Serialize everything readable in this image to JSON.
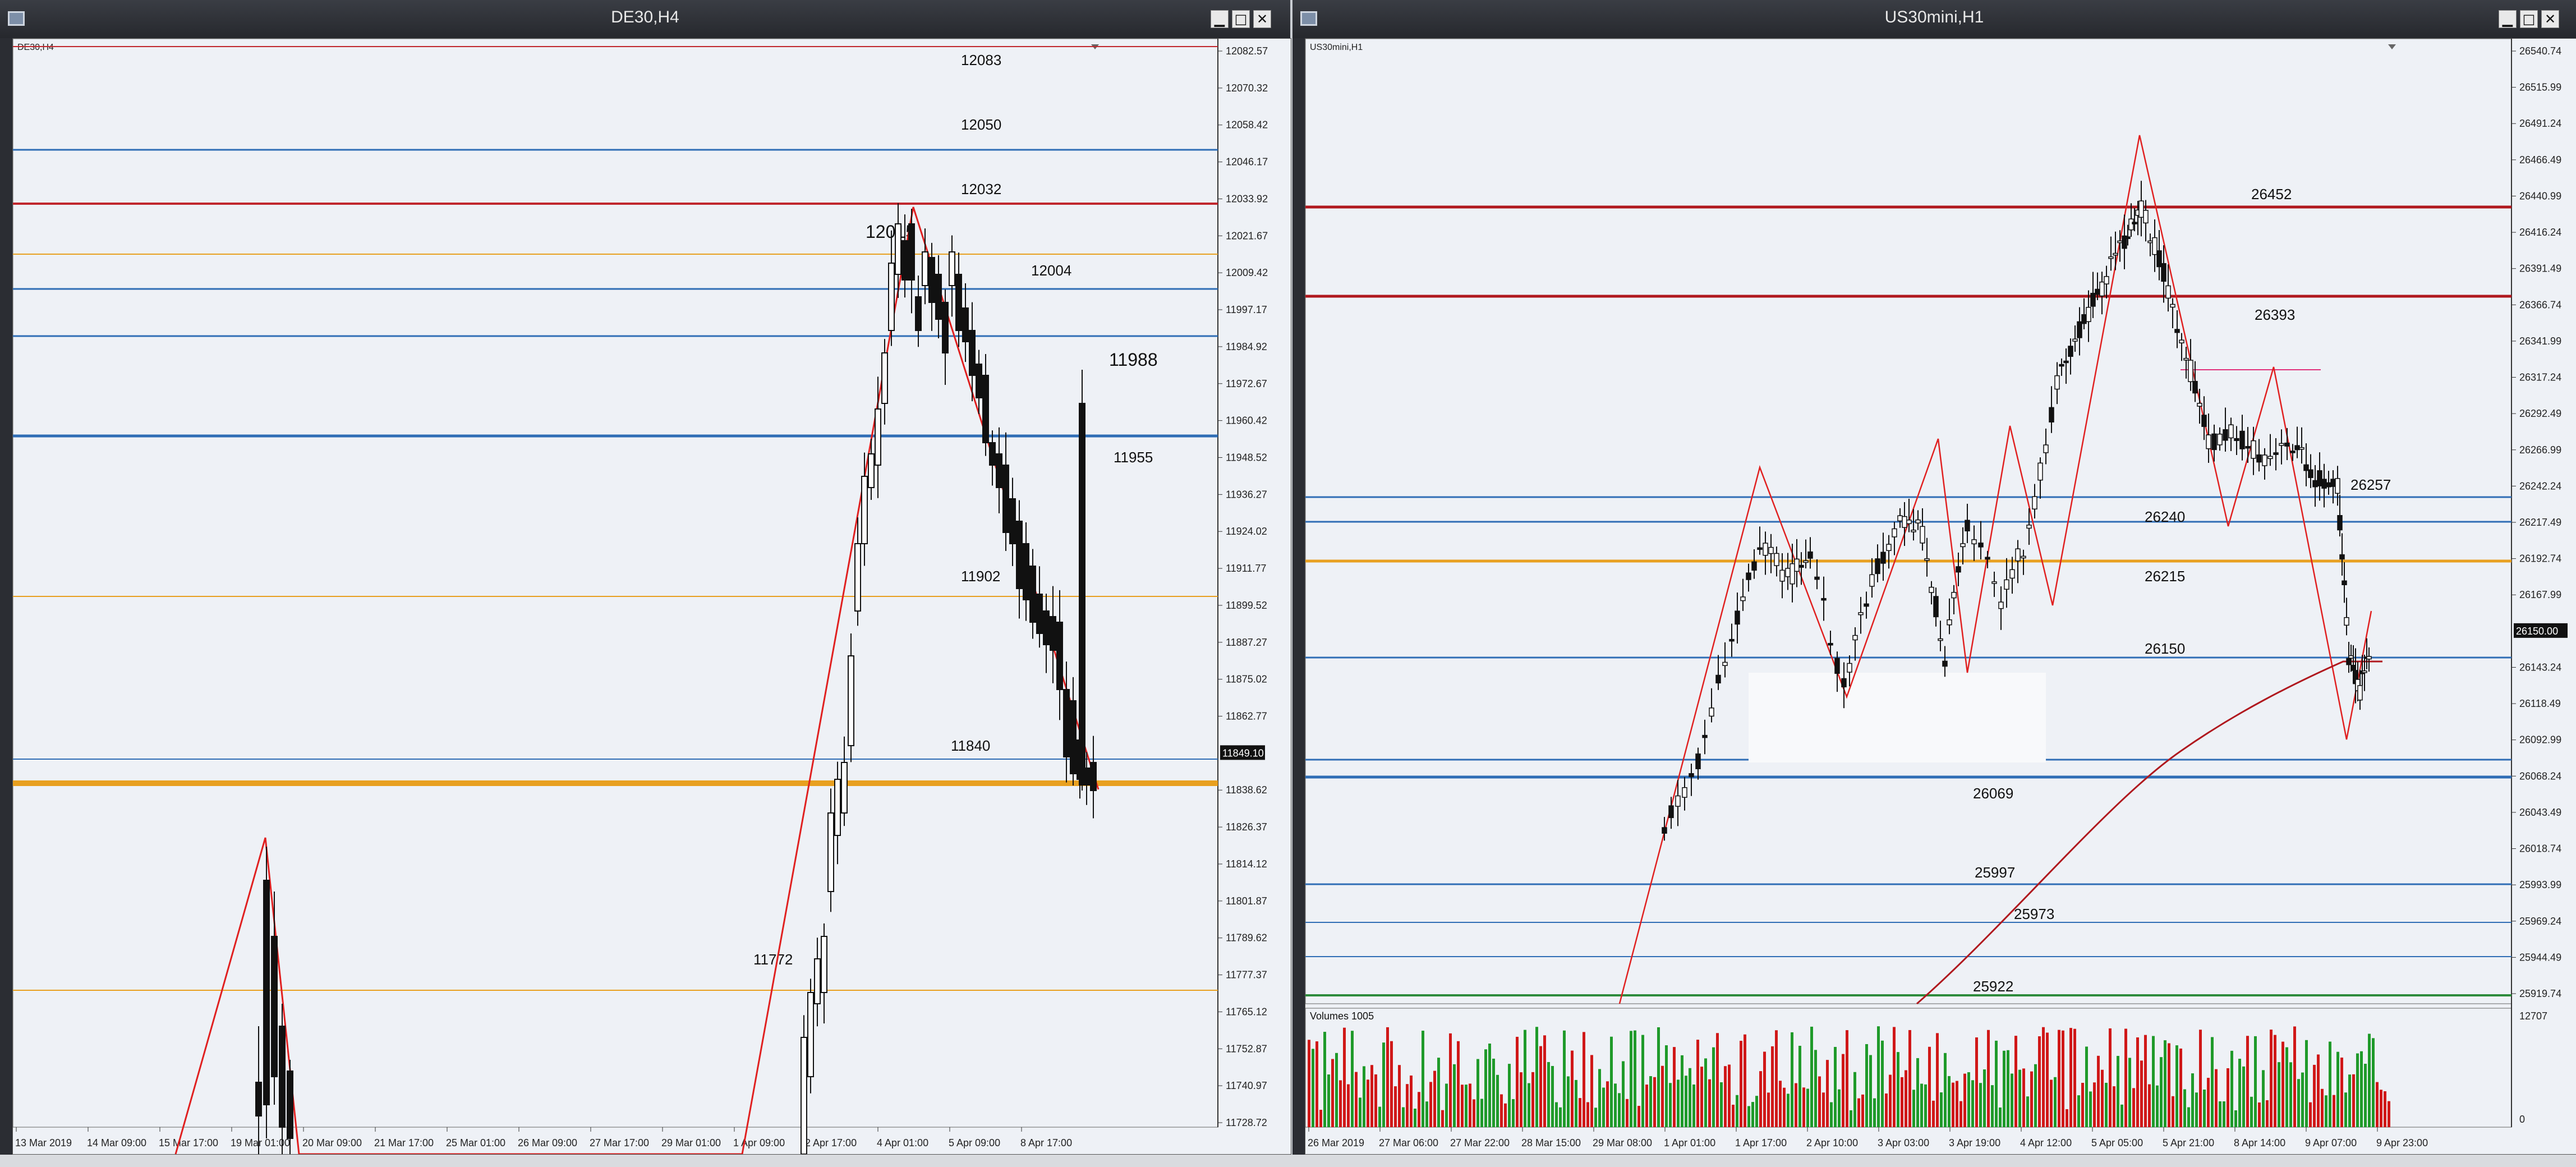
{
  "windows": [
    {
      "title": "DE30,H4",
      "symbol_label": "DE30,H4",
      "price_ticks": [
        "12082.57",
        "12070.32",
        "12058.42",
        "12046.17",
        "12033.92",
        "12021.67",
        "12009.42",
        "11997.17",
        "11984.92",
        "11972.67",
        "11960.42",
        "11948.52",
        "11936.27",
        "11924.02",
        "11911.77",
        "11899.52",
        "11887.27",
        "11875.02",
        "11862.77",
        "11849.10",
        "11838.62",
        "11826.37",
        "11814.12",
        "11801.87",
        "11789.62",
        "11777.37",
        "11765.12",
        "11752.87",
        "11740.97",
        "11728.72"
      ],
      "current_price": "11849.10",
      "time_labels": [
        "13 Mar 2019",
        "14 Mar 09:00",
        "15 Mar 17:00",
        "19 Mar 01:00",
        "20 Mar 09:00",
        "21 Mar 17:00",
        "25 Mar 01:00",
        "26 Mar 09:00",
        "27 Mar 17:00",
        "29 Mar 01:00",
        "1 Apr 09:00",
        "2 Apr 17:00",
        "4 Apr 01:00",
        "5 Apr 09:00",
        "8 Apr 17:00"
      ],
      "level_labels": [
        "12083",
        "12050",
        "12032",
        "12015",
        "12004",
        "11988",
        "11955",
        "11902",
        "11840",
        "11772"
      ],
      "line_colors": {
        "red": "#c0272d",
        "blue": "#2f6db5",
        "orange": "#e8a020",
        "zigzag": "#e02020"
      }
    },
    {
      "title": "US30mini,H1",
      "symbol_label": "US30mini,H1",
      "price_ticks": [
        "26540.74",
        "26515.99",
        "26491.24",
        "26466.49",
        "26440.99",
        "26416.24",
        "26391.49",
        "26366.74",
        "26341.99",
        "26317.24",
        "26292.49",
        "26266.99",
        "26242.24",
        "26217.49",
        "26192.74",
        "26167.99",
        "26150.00",
        "26143.24",
        "26118.49",
        "26092.99",
        "26068.24",
        "26043.49",
        "26018.74",
        "25993.99",
        "25969.24",
        "25944.49",
        "25919.74"
      ],
      "current_price": "26150.00",
      "time_labels": [
        "26 Mar 2019",
        "27 Mar 06:00",
        "27 Mar 22:00",
        "28 Mar 15:00",
        "29 Mar 08:00",
        "1 Apr 01:00",
        "1 Apr 17:00",
        "2 Apr 10:00",
        "3 Apr 03:00",
        "3 Apr 19:00",
        "4 Apr 12:00",
        "5 Apr 05:00",
        "5 Apr 21:00",
        "8 Apr 14:00",
        "9 Apr 07:00",
        "9 Apr 23:00"
      ],
      "level_labels": [
        "26452",
        "26393",
        "26257",
        "26240",
        "26215",
        "26150",
        "26069",
        "25997",
        "25973",
        "25922"
      ],
      "volume_label": "Volumes 1005",
      "volume_ticks": [
        "12707",
        "0"
      ],
      "line_colors": {
        "red": "#b0181e",
        "blue": "#2f6db5",
        "orange": "#e8a020",
        "green": "#2e8b3c",
        "ma": "#b0181e",
        "volume_up": "#1f9a2a",
        "volume_down": "#d01818"
      }
    }
  ]
}
